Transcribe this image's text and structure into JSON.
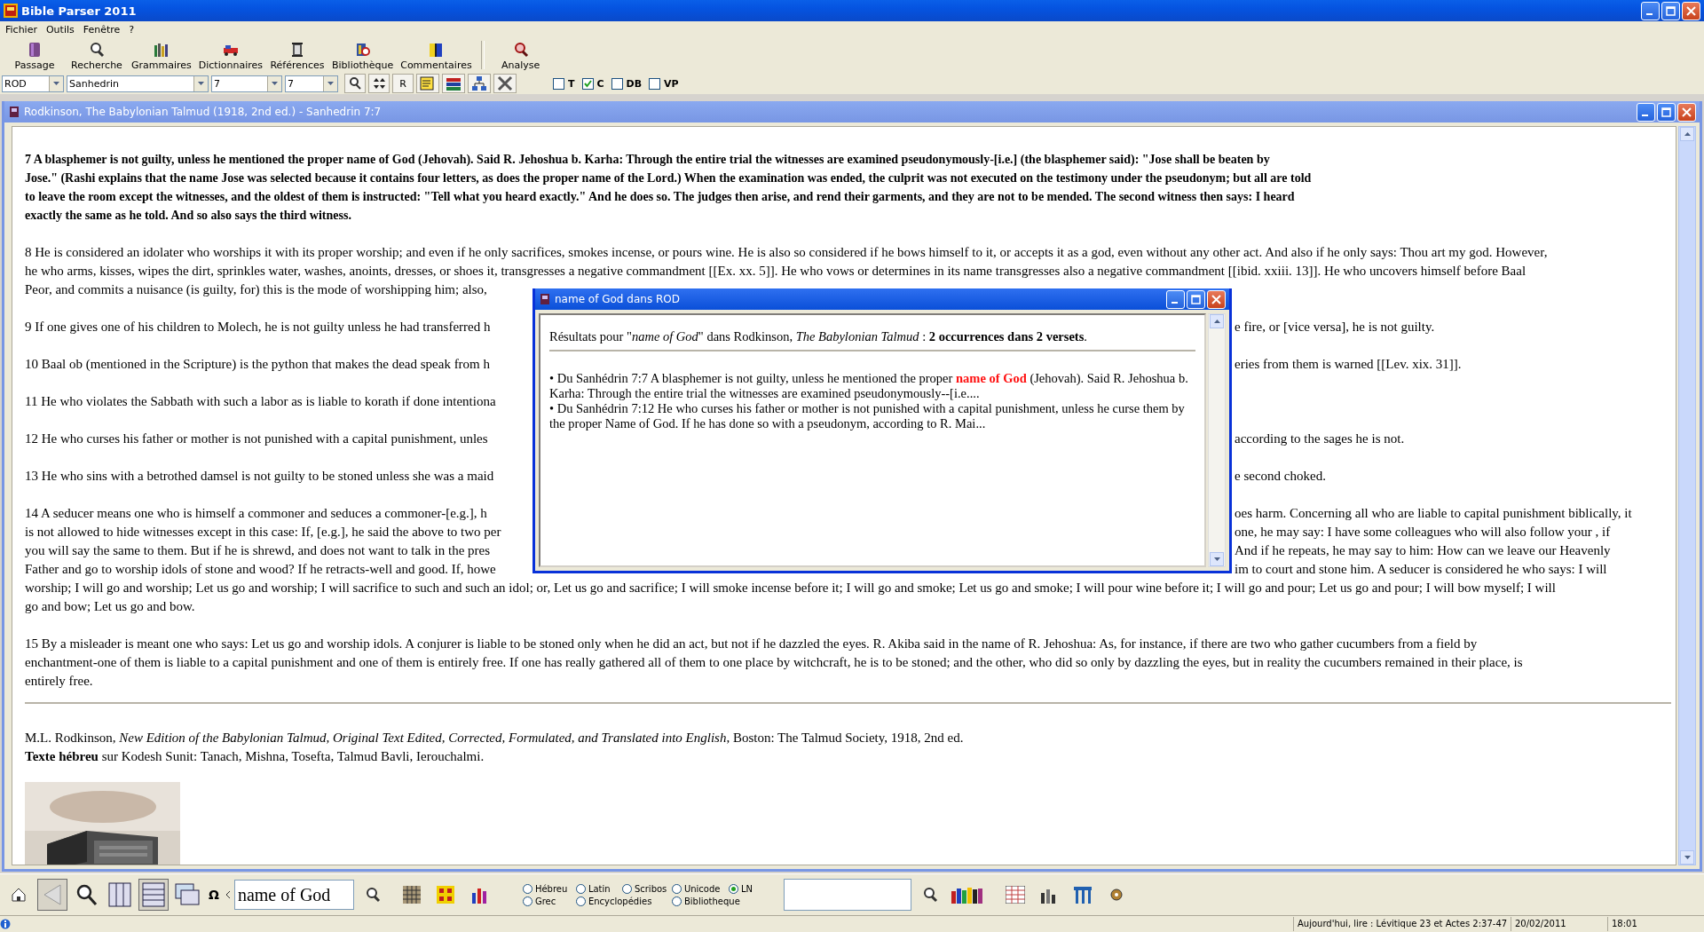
{
  "window": {
    "title": "Bible Parser 2011"
  },
  "menu": [
    "Fichier",
    "Outils",
    "Fenêtre",
    "?"
  ],
  "toolbar_groups": [
    [
      "Passage",
      "Recherche",
      "Grammaires",
      "Dictionnaires",
      "Références",
      "Bibliothèque",
      "Commentaires"
    ],
    [
      "Analyse"
    ]
  ],
  "selectors": [
    {
      "value": "ROD"
    },
    {
      "value": "Sanhedrin"
    },
    {
      "value": "7"
    },
    {
      "value": "7"
    }
  ],
  "r_button": "R",
  "filters": [
    {
      "label": "T",
      "checked": false
    },
    {
      "label": "C",
      "checked": true
    },
    {
      "label": "DB",
      "checked": false
    },
    {
      "label": "VP",
      "checked": false
    }
  ],
  "document_window": {
    "title": "Rodkinson, The Babylonian Talmud (1918, 2nd ed.) - Sanhedrin 7:7",
    "paragraphs": [
      {
        "bold": true,
        "lines": [
          {
            "text": "7 A blasphemer is not guilty, unless he mentioned the proper name of God (Jehovah). Said R. Jehoshua b. Karha: Through the entire trial the witnesses are examined pseudonymously-[i.e.] (the blasphemer said): \"Jose shall be beaten by"
          },
          {
            "text": "Jose.\" (Rashi explains that the name Jose was selected because it contains four letters, as does the proper name of the Lord.) When the examination was ended, the culprit was not executed on the testimony under the pseudonym; but all are told"
          },
          {
            "text": "to leave the room except the witnesses, and the oldest of them is instructed: \"Tell what you heard exactly.\" And he does so. The judges then arise, and rend their garments, and they are not to be mended. The second witness then says: I heard"
          },
          {
            "text": "exactly the same as he told. And so also says the third witness."
          }
        ]
      },
      {
        "bold": false,
        "lines": [
          {
            "text": "8 He is considered an idolater who worships it with its proper worship; and even if he only sacrifices, smokes incense, or pours wine. He is also so considered if he bows himself to it, or accepts it as a god, even without any other act. And also if he only says: Thou art my god. However,"
          },
          {
            "text": "he who arms, kisses, wipes the dirt, sprinkles water, washes, anoints, dresses, or shoes it, transgresses a negative commandment [[Ex. xx. 5]]. He who vows or determines in its name transgresses also a negative commandment [[ibid. xxiii. 13]]. He who uncovers himself before Baal"
          },
          {
            "text": "Peor, and commits a nuisance (is guilty, for) this is the mode of worshipping him; also,"
          }
        ]
      },
      {
        "bold": false,
        "lines": [
          {
            "left": "9 If one gives one of his children to Molech, he is not guilty unless he had transferred h",
            "right": "e fire, or [vice versa], he is not guilty."
          }
        ]
      },
      {
        "bold": false,
        "lines": [
          {
            "left": "10 Baal ob (mentioned in the Scripture) is the python that makes the dead speak from h",
            "right": "eries from them is warned [[Lev. xix. 31]]."
          }
        ]
      },
      {
        "bold": false,
        "lines": [
          {
            "left": "11 He who violates the Sabbath with such a labor as is liable to korath if done intentiona"
          }
        ]
      },
      {
        "bold": false,
        "lines": [
          {
            "left": "12 He who curses his father or mother is not punished with a capital punishment, unles",
            "right": "according to the sages he is not."
          }
        ]
      },
      {
        "bold": false,
        "lines": [
          {
            "left": "13 He who sins with a betrothed damsel is not guilty to be stoned unless she was a maid",
            "right": "e second choked."
          }
        ]
      },
      {
        "bold": false,
        "lines": [
          {
            "left": "14 A seducer means one who is himself a commoner and seduces a commoner-[e.g.], h",
            "right": "oes harm. Concerning all who are liable to capital punishment biblically, it"
          },
          {
            "left": "is not allowed to hide witnesses except in this case: If, [e.g.], he said the above to two per",
            "right": "one, he may say: I have some colleagues who will also follow your , if"
          },
          {
            "left": "you will say the same to them. But if he is shrewd, and does not want to talk in the pres",
            "right": "And if he repeats, he may say to him: How can we leave our Heavenly"
          },
          {
            "left": "Father and go to worship idols of stone and wood? If he retracts-well and good. If, howe",
            "right": "im to court and stone him. A seducer is considered he who says: I will"
          },
          {
            "text": "worship; I will go and worship; Let us go and worship; I will sacrifice to such and such an idol; or, Let us go and sacrifice; I will smoke incense before it; I will go and smoke; Let us go and smoke; I will pour wine before it; I will go and pour; Let us go and pour; I will bow myself; I will"
          },
          {
            "text": "go and bow; Let us go and bow."
          }
        ]
      },
      {
        "bold": false,
        "lines": [
          {
            "text": "15 By a misleader is meant one who says: Let us go and worship idols. A conjurer is liable to be stoned only when he did an act, but not if he dazzled the eyes. R. Akiba said in the name of R. Jehoshua: As, for instance, if there are two who gather cucumbers from a field by"
          },
          {
            "text": "enchantment-one of them is liable to a capital punishment and one of them is entirely free. If one has really gathered all of them to one place by witchcraft, he is to be stoned; and the other, who did so only by dazzling the eyes, but in reality the cucumbers remained in their place, is"
          },
          {
            "text": "entirely free."
          }
        ]
      }
    ],
    "citation": [
      "M.L. Rodkinson, *New Edition of the Babylonian Talmud, Original Text Edited, Corrected, Formulated, and Translated into English*, Boston: The Talmud Society, 1918, 2nd ed.",
      "**Texte hébreu** sur Kodesh Sunit: Tanach, Mishna, Tosefta, Talmud Bavli, Ierouchalmi."
    ]
  },
  "search_popup": {
    "title": "name of God dans ROD",
    "summary": "Résultats pour \"*name of God*\" dans Rodkinson, *The Babylonian Talmud* : **2 occurrences dans 2 versets**.",
    "results": [
      {
        "before": "• Du Sanhédrin 7:7 A blasphemer is not guilty, unless he mentioned the proper ",
        "match": "name of God",
        "after": " (Jehovah). Said R. Jehoshua b. Karha: Through the entire trial the witnesses are examined pseudonymously--[i.e...."
      },
      {
        "before": "• Du Sanhédrin 7:12 He who curses his father or mother is not punished with a capital punishment, unless he curse them by the proper Name of God. If he has done so with a pseudonym, according to R. Mai..."
      }
    ]
  },
  "bottom_bar": {
    "omega": "Ω",
    "search_field": {
      "value": "name of God"
    },
    "scripts": [
      [
        {
          "label": "Hébreu",
          "selected": false
        },
        {
          "label": "Latin",
          "selected": false
        },
        {
          "label": "Scribos",
          "selected": false
        },
        {
          "label": "Unicode",
          "selected": false
        },
        {
          "label": "LN",
          "selected": true
        }
      ],
      [
        {
          "label": "Grec",
          "selected": false
        },
        {
          "label": "Encyclopédies",
          "selected": false
        },
        {
          "label": "Bibliotheque",
          "selected": false
        }
      ]
    ]
  },
  "status_bar": {
    "reading": "Aujourd'hui, lire : Lévitique 23 et Actes 2:37-47",
    "date": "20/02/2011",
    "time": "18:01"
  }
}
